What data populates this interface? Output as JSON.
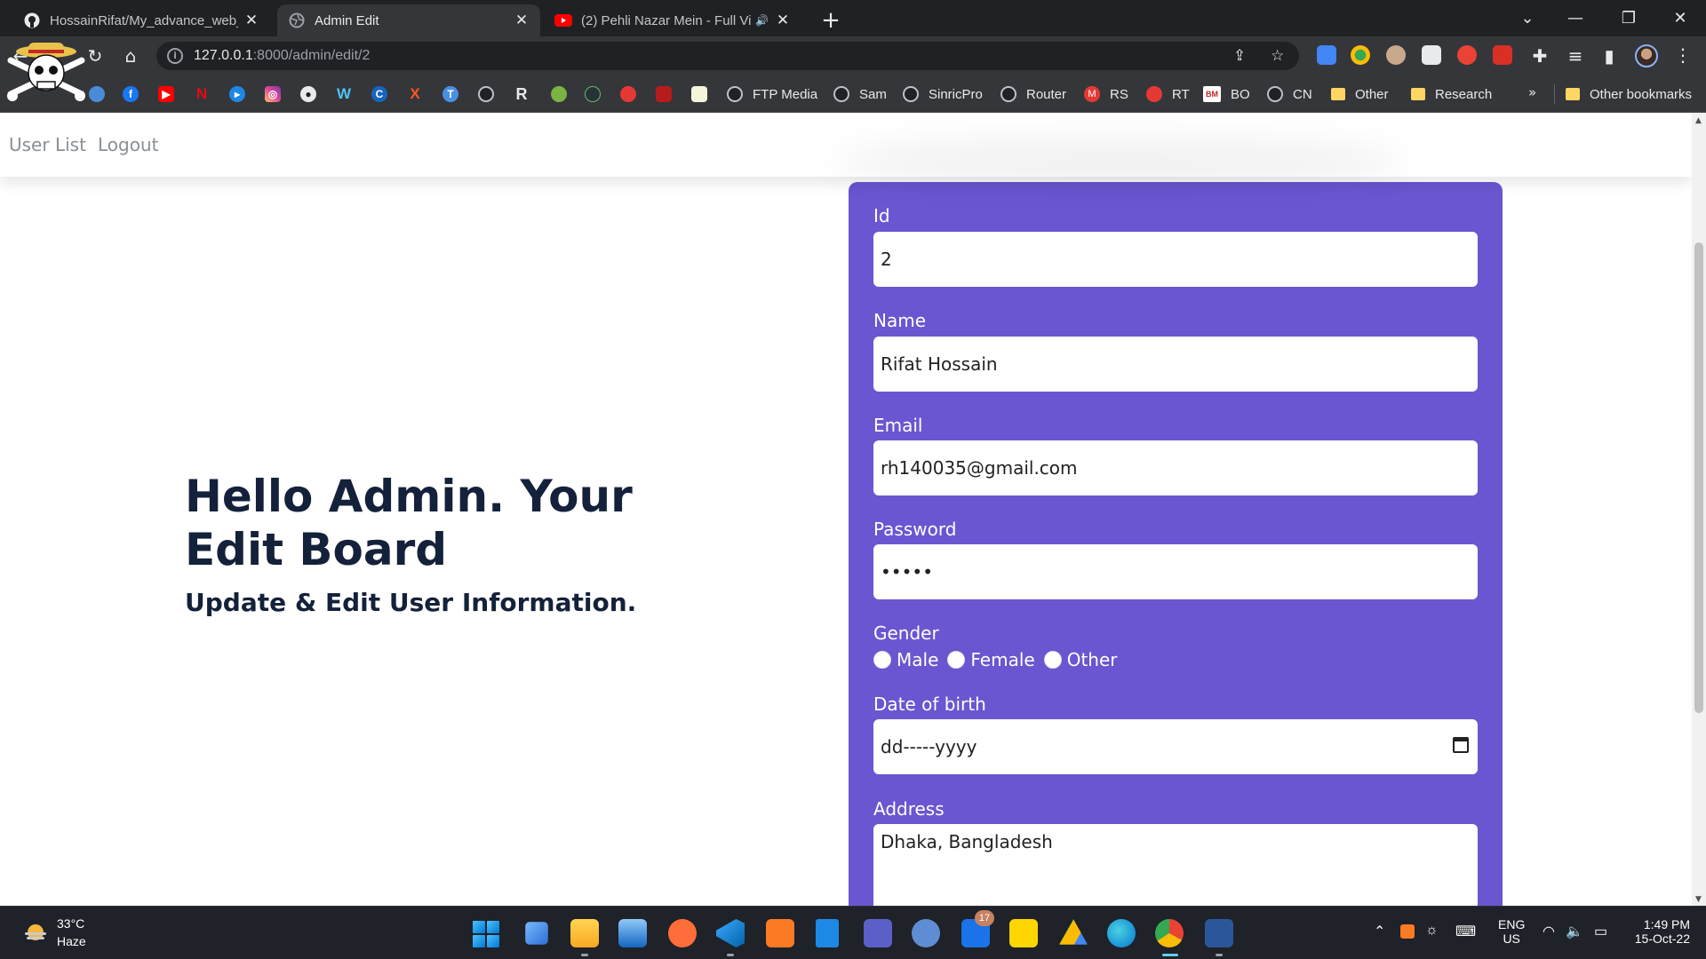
{
  "browser": {
    "tabs": [
      {
        "title": "HossainRifat/My_advance_web_V",
        "active": false,
        "icon": "github-icon"
      },
      {
        "title": "Admin Edit",
        "active": true,
        "icon": "globe-icon"
      },
      {
        "title": "(2) Pehli Nazar Mein - Full Vi",
        "active": false,
        "icon": "youtube-icon",
        "audio": true
      }
    ],
    "url_host": "127.0.0.1",
    "url_rest": ":8000/admin/edit/2",
    "bookmarks": [
      {
        "label": "FTP Media"
      },
      {
        "label": "Sam"
      },
      {
        "label": "SinricPro"
      },
      {
        "label": "Router"
      },
      {
        "label": "RS"
      },
      {
        "label": "RT"
      },
      {
        "label": "BO"
      },
      {
        "label": "CN"
      },
      {
        "label": "Other"
      },
      {
        "label": "Research"
      }
    ],
    "overflow_label": "»",
    "other_bookmarks": "Other bookmarks",
    "bookmark_icon_letters": {
      "netflix": "N",
      "r": "R",
      "x": "X",
      "c": "C",
      "w": "W",
      "m": "M",
      "bm": "BM"
    }
  },
  "site": {
    "nav": {
      "user_list": "User List",
      "logout": "Logout"
    },
    "hero": {
      "title": "Hello Admin. Your Edit Board",
      "subtitle": "Update & Edit User Information."
    },
    "form": {
      "id_label": "Id",
      "id_value": "2",
      "name_label": "Name",
      "name_value": "Rifat Hossain",
      "email_label": "Email",
      "email_value": "rh140035@gmail.com",
      "password_label": "Password",
      "password_value": "•••••",
      "gender_label": "Gender",
      "gender_options": [
        "Male",
        "Female",
        "Other"
      ],
      "dob_label": "Date of birth",
      "dob_value": "dd-----yyyy",
      "address_label": "Address",
      "address_value": "Dhaka, Bangladesh"
    },
    "colors": {
      "card": "#6a56d1",
      "heading": "#14213a"
    }
  },
  "taskbar": {
    "weather_temp": "33°C",
    "weather_condition": "Haze",
    "teams_badge": "17",
    "lang_line1": "ENG",
    "lang_line2": "US",
    "time": "1:49 PM",
    "date": "15-Oct-22"
  }
}
